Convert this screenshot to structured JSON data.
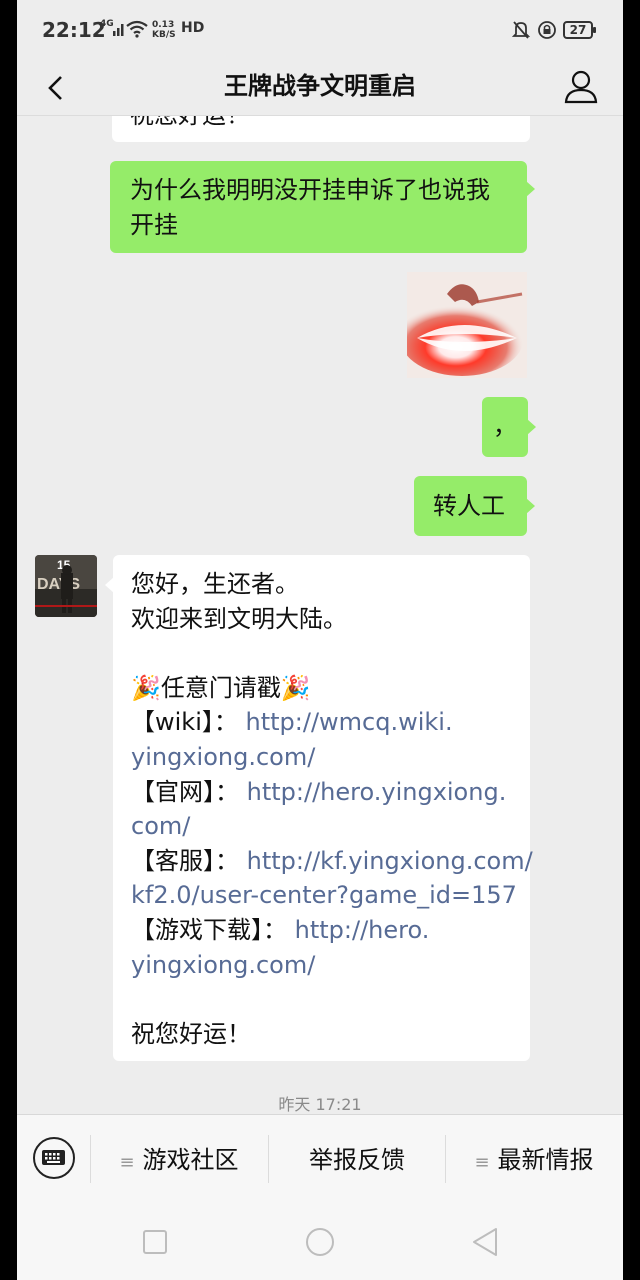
{
  "status_bar": {
    "time": "22:12",
    "network": "4G",
    "speed_value": "0.13",
    "speed_unit": "KB/S",
    "hd": "HD",
    "battery": "27"
  },
  "nav": {
    "title": "王牌战争文明重启"
  },
  "messages": {
    "top_partial": "祝您好运！",
    "question_line1": "为什么我明明没开挂申诉了也说我",
    "question_line2": "开挂",
    "comma": "，",
    "transfer": "转人工",
    "reply": {
      "l1": "您好，生还者。",
      "l2": "欢迎来到文明大陆。",
      "l3": "🎉任意门请戳🎉",
      "wiki_label": "【wiki】：",
      "wiki_url_1": "http://wmcq.wiki.",
      "wiki_url_2": "yingxiong.com/",
      "site_label": "【官网】：",
      "site_url_1": "http://hero.yingxiong.",
      "site_url_2": "com/",
      "cs_label": "【客服】：",
      "cs_url_1": "http://kf.yingxiong.com/",
      "cs_url_2": "kf2.0/user-center?game_id=157",
      "dl_label": "【游戏下载】：",
      "dl_url_1": "http://hero.",
      "dl_url_2": "yingxiong.com/",
      "closing": "祝您好运！"
    },
    "avatar_text": "15 DAYS",
    "timestamp": "昨天 17:21"
  },
  "menu": {
    "item1": "游戏社区",
    "item2": "举报反馈",
    "item3": "最新情报",
    "hamburger": "≡"
  },
  "colors": {
    "background": "#ededed",
    "bubble_sent": "#95ec69",
    "bubble_received": "#ffffff",
    "link": "#576b95"
  },
  "icons": {
    "back": "chevron-left-icon",
    "user": "user-icon",
    "keyboard": "keyboard-icon",
    "square": "recent-apps-icon",
    "circle": "home-icon",
    "triangle": "back-triangle-icon"
  }
}
